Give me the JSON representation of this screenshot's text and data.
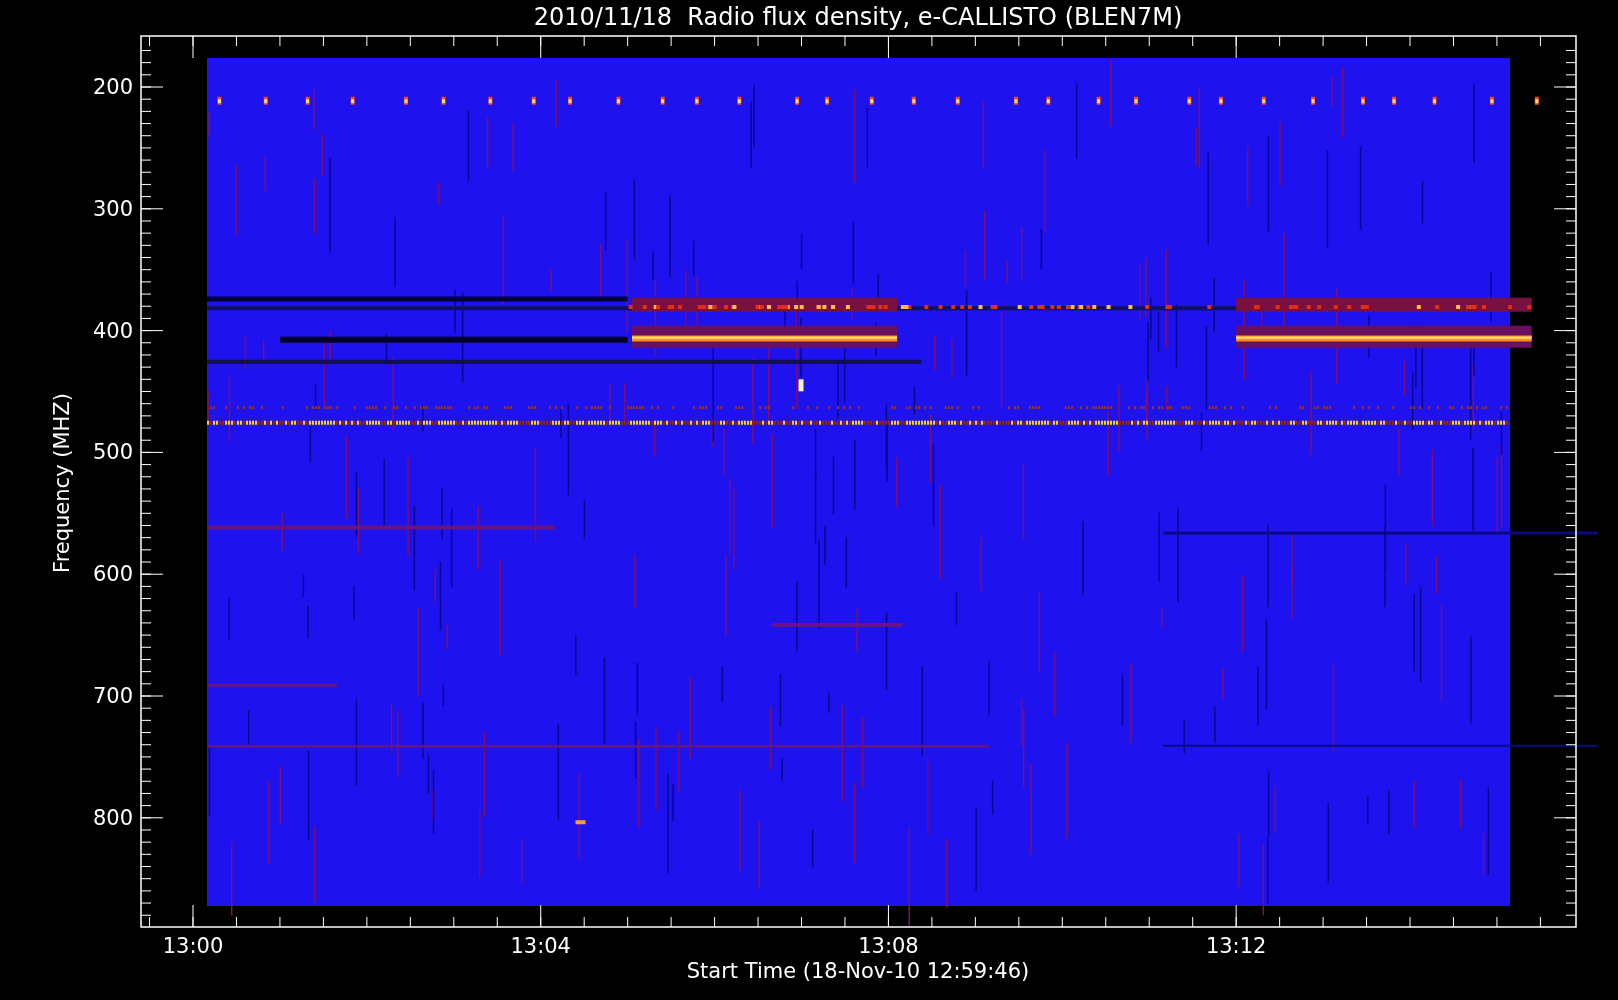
{
  "title": "2010/11/18  Radio flux density, e-CALLISTO (BLEN7M)",
  "y_axis": {
    "label": "Frequency (MHZ)",
    "ticks": [
      "200",
      "300",
      "400",
      "500",
      "600",
      "700",
      "800"
    ]
  },
  "x_axis": {
    "label": "Start Time (18-Nov-10 12:59:46)",
    "ticks": [
      "13:00",
      "13:04",
      "13:08",
      "13:12"
    ]
  }
}
